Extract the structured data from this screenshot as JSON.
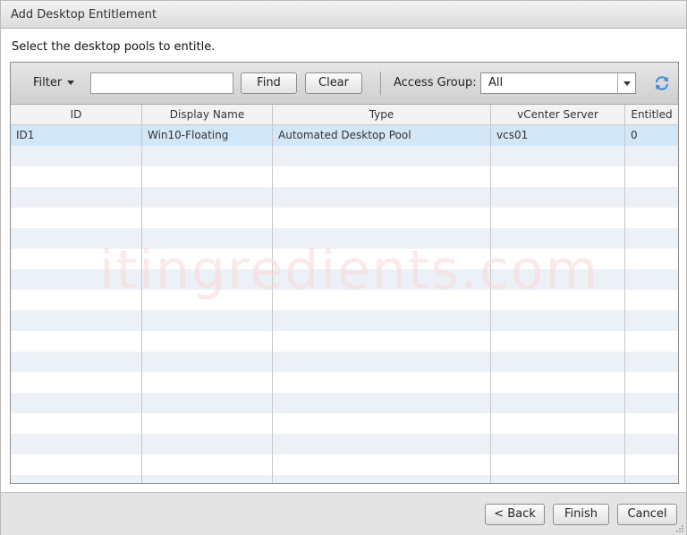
{
  "dialog": {
    "title": "Add Desktop Entitlement",
    "instruction": "Select the desktop pools to entitle."
  },
  "toolbar": {
    "filter_label": "Filter",
    "filter_value": "",
    "find_label": "Find",
    "clear_label": "Clear",
    "access_group_label": "Access Group:",
    "access_group_value": "All",
    "refresh_icon": "refresh-icon"
  },
  "grid": {
    "columns": [
      "ID",
      "Display Name",
      "Type",
      "vCenter Server",
      "Entitled"
    ],
    "rows": [
      [
        "ID1",
        "Win10-Floating",
        "Automated Desktop Pool",
        "vcs01",
        "0"
      ]
    ]
  },
  "watermark": "itingredients.com",
  "footer": {
    "back_label": "< Back",
    "finish_label": "Finish",
    "cancel_label": "Cancel"
  },
  "colors": {
    "selected_row": "#d2e7f7",
    "alt_row": "#ecf1f7",
    "refresh_icon": "#3f8fd6"
  }
}
